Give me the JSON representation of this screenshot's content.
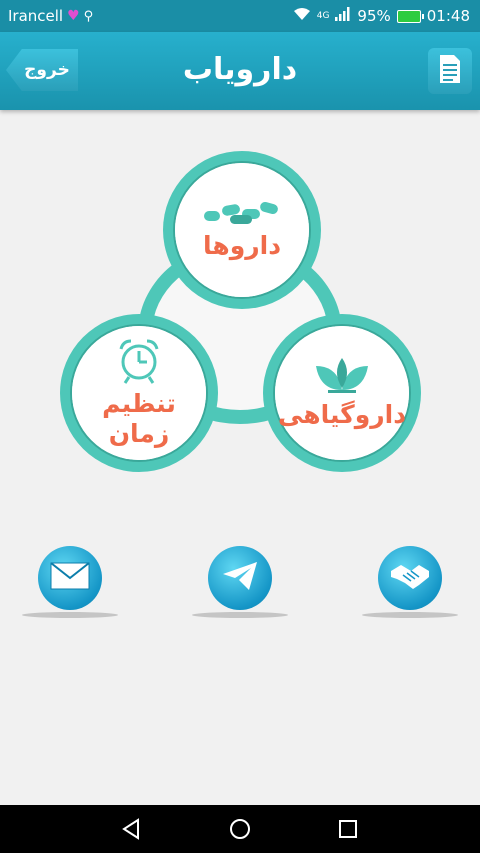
{
  "status_bar": {
    "carrier": "Irancell",
    "network": "4G",
    "battery": "95%",
    "time": "01:48"
  },
  "header": {
    "exit_label": "خروج",
    "title": "دارویاب"
  },
  "menu": {
    "drugs_label": "داروها",
    "herbal_label": "داروگیاهی",
    "time_label_line1": "تنظیم",
    "time_label_line2": "زمان"
  },
  "icons": {
    "exit": "back-arrow-icon",
    "document": "document-icon",
    "pills": "pills-icon",
    "leaf": "leaf-icon",
    "clock": "alarm-clock-icon",
    "mail": "mail-icon",
    "telegram": "telegram-icon",
    "handshake": "handshake-icon"
  },
  "colors": {
    "header": "#1a93ad",
    "teal_ring": "#4ec7b8",
    "label": "#ef6b4a"
  }
}
